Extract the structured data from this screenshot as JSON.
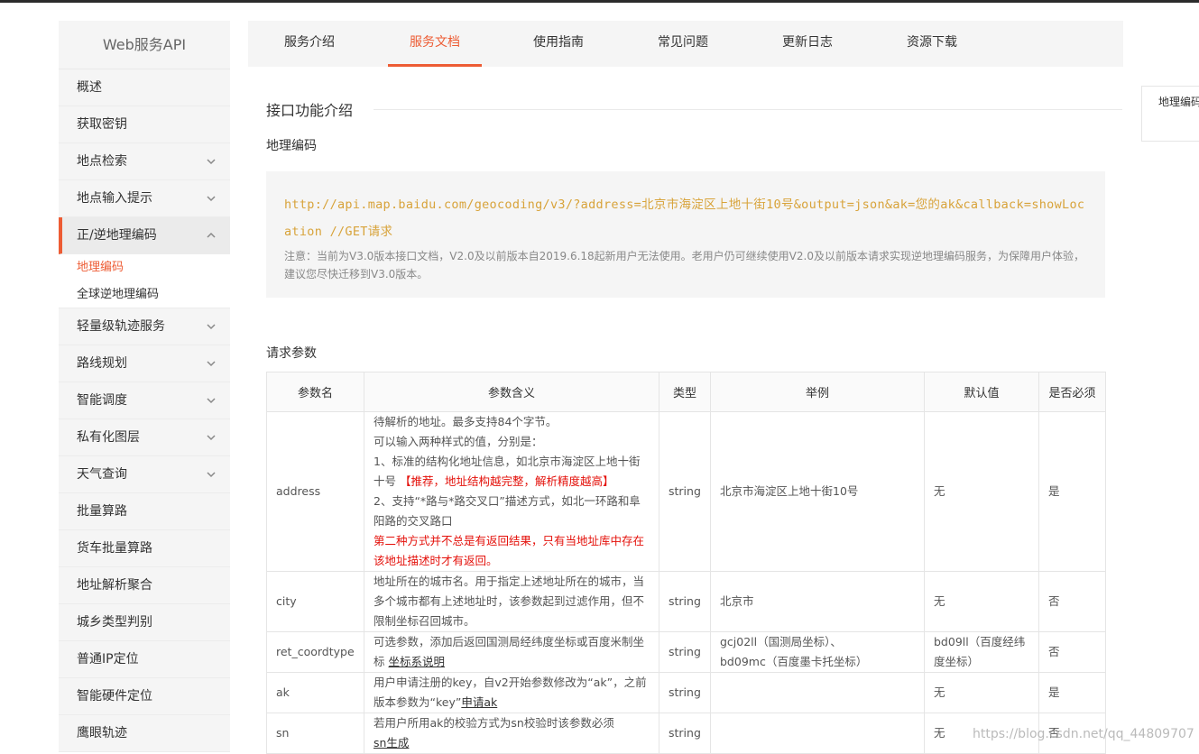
{
  "sidebar": {
    "title": "Web服务API",
    "items": [
      {
        "label": "概述",
        "chevron": ""
      },
      {
        "label": "获取密钥",
        "chevron": ""
      },
      {
        "label": "地点检索",
        "chevron": "down"
      },
      {
        "label": "地点输入提示",
        "chevron": "down"
      },
      {
        "label": "正/逆地理编码",
        "chevron": "up"
      },
      {
        "label": "轻量级轨迹服务",
        "chevron": "down"
      },
      {
        "label": "路线规划",
        "chevron": "down"
      },
      {
        "label": "智能调度",
        "chevron": "down"
      },
      {
        "label": "私有化图层",
        "chevron": "down"
      },
      {
        "label": "天气查询",
        "chevron": "down"
      },
      {
        "label": "批量算路",
        "chevron": ""
      },
      {
        "label": "货车批量算路",
        "chevron": ""
      },
      {
        "label": "地址解析聚合",
        "chevron": ""
      },
      {
        "label": "城乡类型判别",
        "chevron": ""
      },
      {
        "label": "普通IP定位",
        "chevron": ""
      },
      {
        "label": "智能硬件定位",
        "chevron": ""
      },
      {
        "label": "鹰眼轨迹",
        "chevron": ""
      }
    ],
    "subitems": [
      {
        "label": "地理编码"
      },
      {
        "label": "全球逆地理编码"
      }
    ]
  },
  "tabs": [
    {
      "label": "服务介绍"
    },
    {
      "label": "服务文档"
    },
    {
      "label": "使用指南"
    },
    {
      "label": "常见问题"
    },
    {
      "label": "更新日志"
    },
    {
      "label": "资源下载"
    }
  ],
  "content": {
    "section_title": "接口功能介绍",
    "subsection_title": "地理编码",
    "code_url": "http://api.map.baidu.com/geocoding/v3/?address=北京市海淀区上地十街10号&output=json&ak=您的ak&callback=showLocation //GET请求",
    "note": "注意：当前为V3.0版本接口文档，V2.0及以前版本自2019.6.18起新用户无法使用。老用户仍可继续使用V2.0及以前版本请求实现逆地理编码服务，为保障用户体验，建议您尽快迁移到V3.0版本。",
    "request_params_title": "请求参数"
  },
  "table": {
    "headers": [
      "参数名",
      "参数含义",
      "类型",
      "举例",
      "默认值",
      "是否必须"
    ],
    "rows": {
      "address": {
        "name": "address",
        "desc1": "待解析的地址。最多支持84个字节。",
        "desc2": "可以输入两种样式的值，分别是：",
        "desc3": "1、标准的结构化地址信息，如北京市海淀区上地十街十号",
        "desc3_red": "【推荐，地址结构越完整，解析精度越高】",
        "desc4": "2、支持“*路与*路交叉口”描述方式，如北一环路和阜阳路的交叉路口",
        "desc5_red": "第二种方式并不总是有返回结果，只有当地址库中存在该地址描述时才有返回。",
        "type": "string",
        "example": "北京市海淀区上地十街10号",
        "default": "无",
        "required": "是"
      },
      "city": {
        "name": "city",
        "desc": "地址所在的城市名。用于指定上述地址所在的城市，当多个城市都有上述地址时，该参数起到过滤作用，但不限制坐标召回城市。",
        "type": "string",
        "example": "北京市",
        "default": "无",
        "required": "否"
      },
      "ret_coordtype": {
        "name": "ret_coordtype",
        "desc": "可选参数，添加后返回国测局经纬度坐标或百度米制坐标",
        "link": "坐标系说明",
        "type": "string",
        "example1": "gcj02ll（国测局坐标）、",
        "example2": "bd09mc（百度墨卡托坐标）",
        "default": "bd09ll（百度经纬度坐标）",
        "required": "否"
      },
      "ak": {
        "name": "ak",
        "desc": "用户申请注册的key，自v2开始参数修改为“ak”，之前版本参数为“key”",
        "link": "申请ak",
        "type": "string",
        "example": "",
        "default": "无",
        "required": "是"
      },
      "sn": {
        "name": "sn",
        "desc": "若用户所用ak的校验方式为sn校验时该参数必须",
        "link": "sn生成",
        "type": "string",
        "example": "",
        "default": "无",
        "required": "否"
      }
    }
  },
  "right_panel": {
    "label": "地理编码"
  },
  "watermark": "https://blog.csdn.net/qq_44809707",
  "colors": {
    "accent": "#ed5c34",
    "code": "#d8a33a",
    "red_text": "#e4100a",
    "sidebar_bg": "#f5f5f5"
  }
}
